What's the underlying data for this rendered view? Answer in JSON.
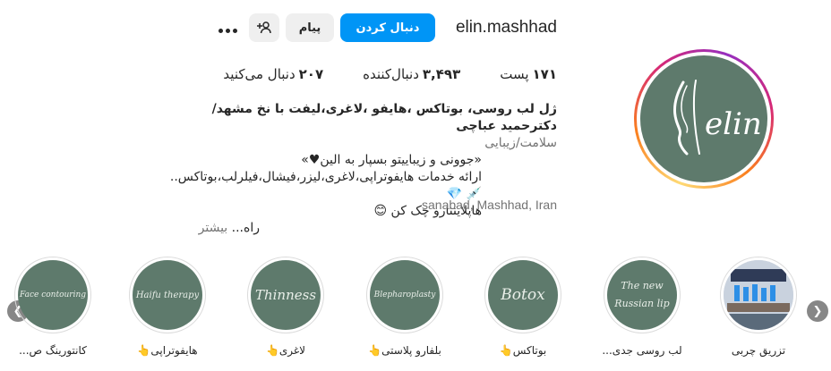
{
  "profile": {
    "username": "elin.mashhad",
    "follow_label": "دنبال کردن",
    "message_label": "پیام",
    "avatar_text": "elin",
    "stats": {
      "posts_count": "۱۷۱",
      "posts_label": "پست",
      "followers_count": "۳,۴۹۳",
      "followers_label": "دنبال‌کننده",
      "following_count": "۲۰۷",
      "following_label": "دنبال می‌کنید"
    },
    "bio": {
      "name": "ژل لب روسی، بوتاکس ،هایفو ،لاغری،لیفت با نخ مشهد/دکترحمید عباچی",
      "category": "سلامت/زیبایی",
      "line1": "«جوونی و زیباییتو بسپار به الین♥»",
      "line2": "ارائه خدمات هایفوتراپی،لاغری،لیزر،فیشال،فیلرلب،بوتاکس.. 💉 💎",
      "line3": "هاپلاینتارو چک کن 😊",
      "line4": "راه... ",
      "more": "بیشتر"
    },
    "location": "sanabad, Mashhad, Iran"
  },
  "highlights": [
    {
      "label": "تزریق چربی",
      "cover": ""
    },
    {
      "label": "لب روسی جدی...",
      "cover": "The new Russian lip"
    },
    {
      "label": "بوتاکس👆",
      "cover": "Botox"
    },
    {
      "label": "بلفارو پلاستی👆",
      "cover": "Blepharoplasty"
    },
    {
      "label": "لاغری👆",
      "cover": "Thinness"
    },
    {
      "label": "هایفوتراپی👆",
      "cover": "Haifu therapy"
    },
    {
      "label": "کانتورینگ ص...",
      "cover": "Face contouring"
    }
  ],
  "colors": {
    "accent": "#0095f6",
    "avatar_bg": "#5e7a6c",
    "button_bg": "#efefef"
  },
  "icons": {
    "more": "more-options-icon",
    "suggest": "add-person-icon",
    "left": "chevron-left-icon",
    "right": "chevron-right-icon"
  }
}
